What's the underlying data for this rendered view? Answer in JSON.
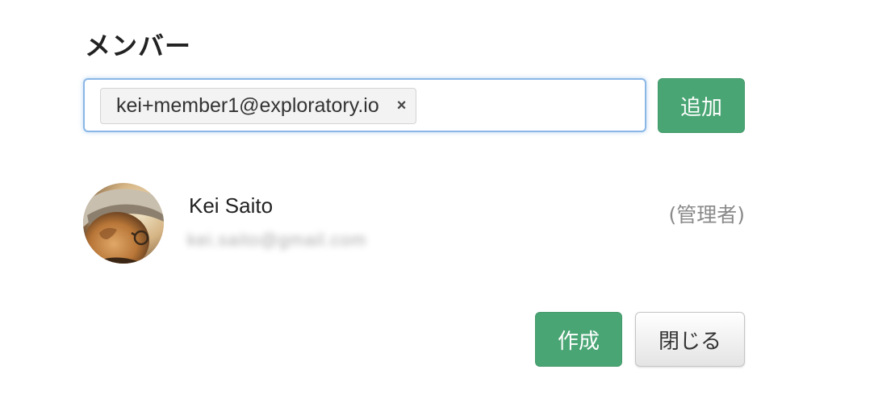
{
  "section": {
    "title": "メンバー"
  },
  "member_input": {
    "tags": [
      {
        "label": "kei+member1@exploratory.io",
        "remove_icon": "×"
      }
    ],
    "add_label": "追加",
    "colors": {
      "focus_border": "#8ab7e6",
      "chip_background": "#f3f3f3"
    }
  },
  "members": [
    {
      "name": "Kei Saito",
      "email": "kei.saito@gmail.com",
      "email_obscured": true,
      "role": "(管理者)",
      "avatar_icon": "user-photo-avatar"
    }
  ],
  "footer": {
    "create_label": "作成",
    "close_label": "閉じる"
  },
  "colors": {
    "primary_button": "#4aa574",
    "role_text": "#8a8a8a"
  }
}
